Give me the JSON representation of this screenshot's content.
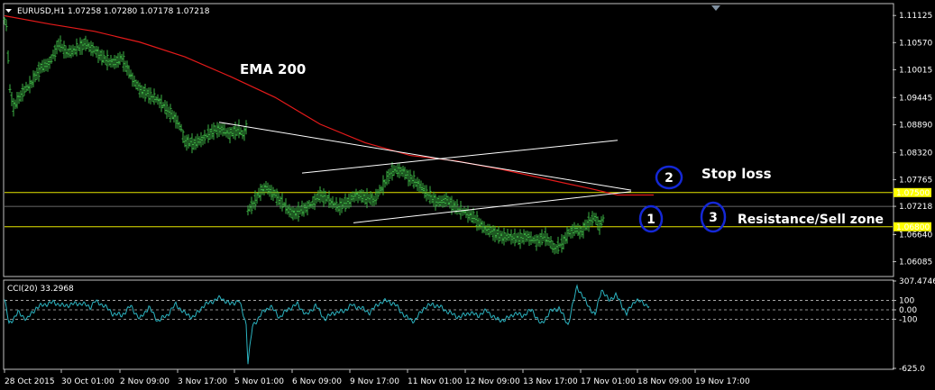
{
  "chart_data": {
    "type": "candlestick",
    "symbol_header": "EURUSD,H1  1.07258 1.07280 1.07178 1.07218",
    "price_axis": {
      "min": 1.058,
      "max": 1.1135,
      "ticks": [
        "1.11125",
        "1.10570",
        "1.10015",
        "1.09445",
        "1.08890",
        "1.08320",
        "1.07765",
        "1.07218",
        "1.06640",
        "1.06085"
      ],
      "highlighted": [
        {
          "label": "1.07500",
          "value": 1.075
        },
        {
          "label": "1.06800",
          "value": 1.068
        }
      ]
    },
    "x_ticks": [
      "28 Oct 2015",
      "30 Oct 01:00",
      "2 Nov 09:00",
      "3 Nov 17:00",
      "5 Nov 01:00",
      "6 Nov 09:00",
      "9 Nov 17:00",
      "11 Nov 01:00",
      "12 Nov 09:00",
      "13 Nov 17:00",
      "17 Nov 01:00",
      "18 Nov 09:00",
      "19 Nov 17:00"
    ],
    "price_path": [
      [
        0,
        1.1105
      ],
      [
        3,
        1.1085
      ],
      [
        5,
        1.097
      ],
      [
        10,
        1.0925
      ],
      [
        20,
        1.0955
      ],
      [
        30,
        1.0975
      ],
      [
        40,
        1.1005
      ],
      [
        50,
        1.1015
      ],
      [
        60,
        1.1055
      ],
      [
        70,
        1.1035
      ],
      [
        80,
        1.1045
      ],
      [
        90,
        1.1055
      ],
      [
        100,
        1.104
      ],
      [
        110,
        1.1025
      ],
      [
        120,
        1.1015
      ],
      [
        130,
        1.1025
      ],
      [
        140,
        1.099
      ],
      [
        150,
        1.096
      ],
      [
        160,
        1.095
      ],
      [
        170,
        1.094
      ],
      [
        180,
        1.092
      ],
      [
        190,
        1.09
      ],
      [
        195,
        1.0885
      ],
      [
        200,
        1.0855
      ],
      [
        210,
        1.085
      ],
      [
        220,
        1.086
      ],
      [
        230,
        1.0875
      ],
      [
        240,
        1.088
      ],
      [
        250,
        1.087
      ],
      [
        260,
        1.088
      ],
      [
        265,
        1.0865
      ],
      [
        268,
        1.0885
      ],
      [
        269,
        1.071
      ],
      [
        275,
        1.0725
      ],
      [
        285,
        1.0755
      ],
      [
        290,
        1.076
      ],
      [
        300,
        1.0745
      ],
      [
        310,
        1.0725
      ],
      [
        320,
        1.0705
      ],
      [
        330,
        1.0715
      ],
      [
        340,
        1.0725
      ],
      [
        350,
        1.0745
      ],
      [
        360,
        1.0735
      ],
      [
        370,
        1.072
      ],
      [
        380,
        1.073
      ],
      [
        390,
        1.0745
      ],
      [
        400,
        1.074
      ],
      [
        410,
        1.0735
      ],
      [
        420,
        1.0765
      ],
      [
        430,
        1.0795
      ],
      [
        440,
        1.0795
      ],
      [
        450,
        1.078
      ],
      [
        460,
        1.0765
      ],
      [
        470,
        1.0745
      ],
      [
        480,
        1.073
      ],
      [
        490,
        1.0735
      ],
      [
        500,
        1.072
      ],
      [
        510,
        1.071
      ],
      [
        520,
        1.07
      ],
      [
        530,
        1.068
      ],
      [
        540,
        1.067
      ],
      [
        550,
        1.066
      ],
      [
        560,
        1.066
      ],
      [
        570,
        1.0655
      ],
      [
        580,
        1.066
      ],
      [
        590,
        1.065
      ],
      [
        600,
        1.066
      ],
      [
        610,
        1.0635
      ],
      [
        618,
        1.0645
      ],
      [
        625,
        1.0665
      ],
      [
        632,
        1.0675
      ],
      [
        640,
        1.067
      ],
      [
        648,
        1.069
      ],
      [
        655,
        1.07
      ],
      [
        660,
        1.068
      ],
      [
        665,
        1.07
      ]
    ],
    "ema": {
      "label": "EMA 200",
      "points": [
        [
          0,
          1.1112
        ],
        [
          50,
          1.1095
        ],
        [
          100,
          1.108
        ],
        [
          150,
          1.1058
        ],
        [
          200,
          1.1028
        ],
        [
          250,
          1.0988
        ],
        [
          300,
          1.0945
        ],
        [
          350,
          1.089
        ],
        [
          400,
          1.0852
        ],
        [
          450,
          1.0826
        ],
        [
          500,
          1.0815
        ],
        [
          550,
          1.0798
        ],
        [
          600,
          1.0778
        ],
        [
          650,
          1.0758
        ],
        [
          680,
          1.0745
        ],
        [
          720,
          1.0745
        ]
      ]
    },
    "trendlines": [
      {
        "from": [
          238,
          1.0894
        ],
        "to": [
          695,
          1.0755
        ]
      },
      {
        "from": [
          387,
          1.0688
        ],
        "to": [
          695,
          1.0752
        ]
      },
      {
        "from": [
          330,
          1.079
        ],
        "to": [
          680,
          1.0857
        ]
      }
    ],
    "annotations": [
      {
        "text": "EMA 200"
      },
      {
        "text": "Stop loss"
      },
      {
        "text": "Resistance/Sell zone"
      }
    ],
    "markers": [
      {
        "text": "1"
      },
      {
        "text": "2"
      },
      {
        "text": "3"
      }
    ],
    "cci": {
      "label": "CCI(20) 33.2968",
      "min": -625.0,
      "max": 307.4746,
      "levels": [
        100,
        0.0,
        -100
      ],
      "ticks": [
        "307.4746",
        "100",
        "0.00",
        "-100",
        "-625.0"
      ],
      "path": [
        [
          0,
          110
        ],
        [
          5,
          -150
        ],
        [
          15,
          -30
        ],
        [
          25,
          -100
        ],
        [
          35,
          20
        ],
        [
          45,
          60
        ],
        [
          55,
          80
        ],
        [
          65,
          40
        ],
        [
          75,
          60
        ],
        [
          85,
          70
        ],
        [
          95,
          30
        ],
        [
          100,
          90
        ],
        [
          110,
          50
        ],
        [
          120,
          -40
        ],
        [
          130,
          -60
        ],
        [
          140,
          40
        ],
        [
          150,
          -100
        ],
        [
          160,
          30
        ],
        [
          170,
          -120
        ],
        [
          180,
          -60
        ],
        [
          190,
          60
        ],
        [
          200,
          -40
        ],
        [
          210,
          -80
        ],
        [
          220,
          40
        ],
        [
          230,
          90
        ],
        [
          240,
          130
        ],
        [
          250,
          60
        ],
        [
          260,
          100
        ],
        [
          268,
          -150
        ],
        [
          270,
          -560
        ],
        [
          275,
          -180
        ],
        [
          285,
          -40
        ],
        [
          295,
          40
        ],
        [
          305,
          -80
        ],
        [
          315,
          10
        ],
        [
          325,
          60
        ],
        [
          335,
          -60
        ],
        [
          345,
          50
        ],
        [
          355,
          -100
        ],
        [
          365,
          -30
        ],
        [
          375,
          -20
        ],
        [
          385,
          50
        ],
        [
          395,
          20
        ],
        [
          405,
          -30
        ],
        [
          415,
          70
        ],
        [
          425,
          100
        ],
        [
          435,
          40
        ],
        [
          445,
          -80
        ],
        [
          455,
          -120
        ],
        [
          465,
          20
        ],
        [
          475,
          60
        ],
        [
          485,
          20
        ],
        [
          495,
          -40
        ],
        [
          505,
          -80
        ],
        [
          515,
          -30
        ],
        [
          525,
          -60
        ],
        [
          535,
          -10
        ],
        [
          545,
          -100
        ],
        [
          555,
          -110
        ],
        [
          565,
          -40
        ],
        [
          575,
          -60
        ],
        [
          585,
          0
        ],
        [
          595,
          -160
        ],
        [
          605,
          -20
        ],
        [
          615,
          20
        ],
        [
          625,
          -160
        ],
        [
          635,
          250
        ],
        [
          645,
          80
        ],
        [
          655,
          -60
        ],
        [
          662,
          220
        ],
        [
          670,
          100
        ],
        [
          678,
          160
        ],
        [
          690,
          -40
        ],
        [
          700,
          110
        ],
        [
          715,
          40
        ]
      ]
    },
    "colors": {
      "background": "#000000",
      "grid": "#c0c0c0",
      "candle": "#3cb043",
      "ema": "#e41a1a",
      "trendline": "#ffffff",
      "level_line": "#e6e600",
      "level_tag": "#ffff00",
      "cci_line": "#2bb3c0",
      "marker_circle": "#1428d6"
    }
  }
}
